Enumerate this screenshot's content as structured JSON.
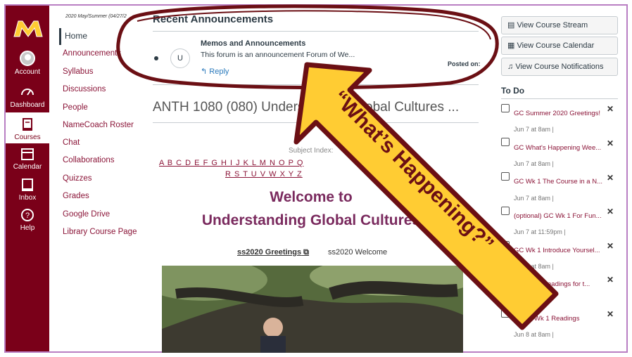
{
  "term": "2020 May/Summer (04/27/2",
  "global_nav": {
    "items": [
      {
        "label": "Account",
        "icon": "account-icon"
      },
      {
        "label": "Dashboard",
        "icon": "dashboard-icon"
      },
      {
        "label": "Courses",
        "icon": "courses-icon"
      },
      {
        "label": "Calendar",
        "icon": "calendar-icon"
      },
      {
        "label": "Inbox",
        "icon": "inbox-icon"
      },
      {
        "label": "Help",
        "icon": "help-icon"
      }
    ]
  },
  "course_nav": {
    "home": "Home",
    "items": [
      "Announcements",
      "Syllabus",
      "Discussions",
      "People",
      "NameCoach Roster",
      "Chat",
      "Collaborations",
      "Quizzes",
      "Grades",
      "Google Drive",
      "Library Course Page"
    ]
  },
  "announcements": {
    "title": "Recent Announcements",
    "avatar": "U",
    "memo_title": "Memos and Announcements",
    "memo_text": "This forum is an announcement Forum of We...",
    "reply": "Reply",
    "posted": "Posted on:"
  },
  "course_title": "ANTH 1080 (080) Understanding Global Cultures ...",
  "subject_index": {
    "label": "Subject Index:",
    "row1": "A B C D E F G H I J K L M N O P Q",
    "row2": "R S T U V W X Y Z"
  },
  "welcome": {
    "line1": "Welcome to",
    "line2": "Understanding Global Cultures"
  },
  "links": {
    "greetings": "ss2020 Greetings",
    "welcome": "ss2020 Welcome"
  },
  "right": {
    "buttons": [
      "View Course Stream",
      "View Course Calendar",
      "View Course Notifications"
    ],
    "todo_heading": "To Do",
    "todos": [
      {
        "title": "GC Summer 2020 Greetings!",
        "date": "Jun 7 at 8am  |"
      },
      {
        "title": "GC What's Happening Wee...",
        "date": "Jun 7 at 8am  |"
      },
      {
        "title": "GC Wk 1 The Course in a N...",
        "date": "Jun 7 at 8am  |"
      },
      {
        "title": "(optional) GC Wk 1 For Fun...",
        "date": "Jun 7 at 11:59pm  |"
      },
      {
        "title": "GC Wk 1 Introduce Yoursel...",
        "date": "Jun 8 at 8am  |"
      },
      {
        "title": "GC Wk 1 Readings for t...",
        "date": ""
      },
      {
        "title": "ss GC Wk 1 Readings",
        "date": "Jun 8 at 8am  |"
      }
    ]
  },
  "overlay_text": "“What’s Happening?”",
  "colors": {
    "maroon": "#7a0019",
    "gold": "#ffcc33",
    "link": "#8b1538"
  }
}
